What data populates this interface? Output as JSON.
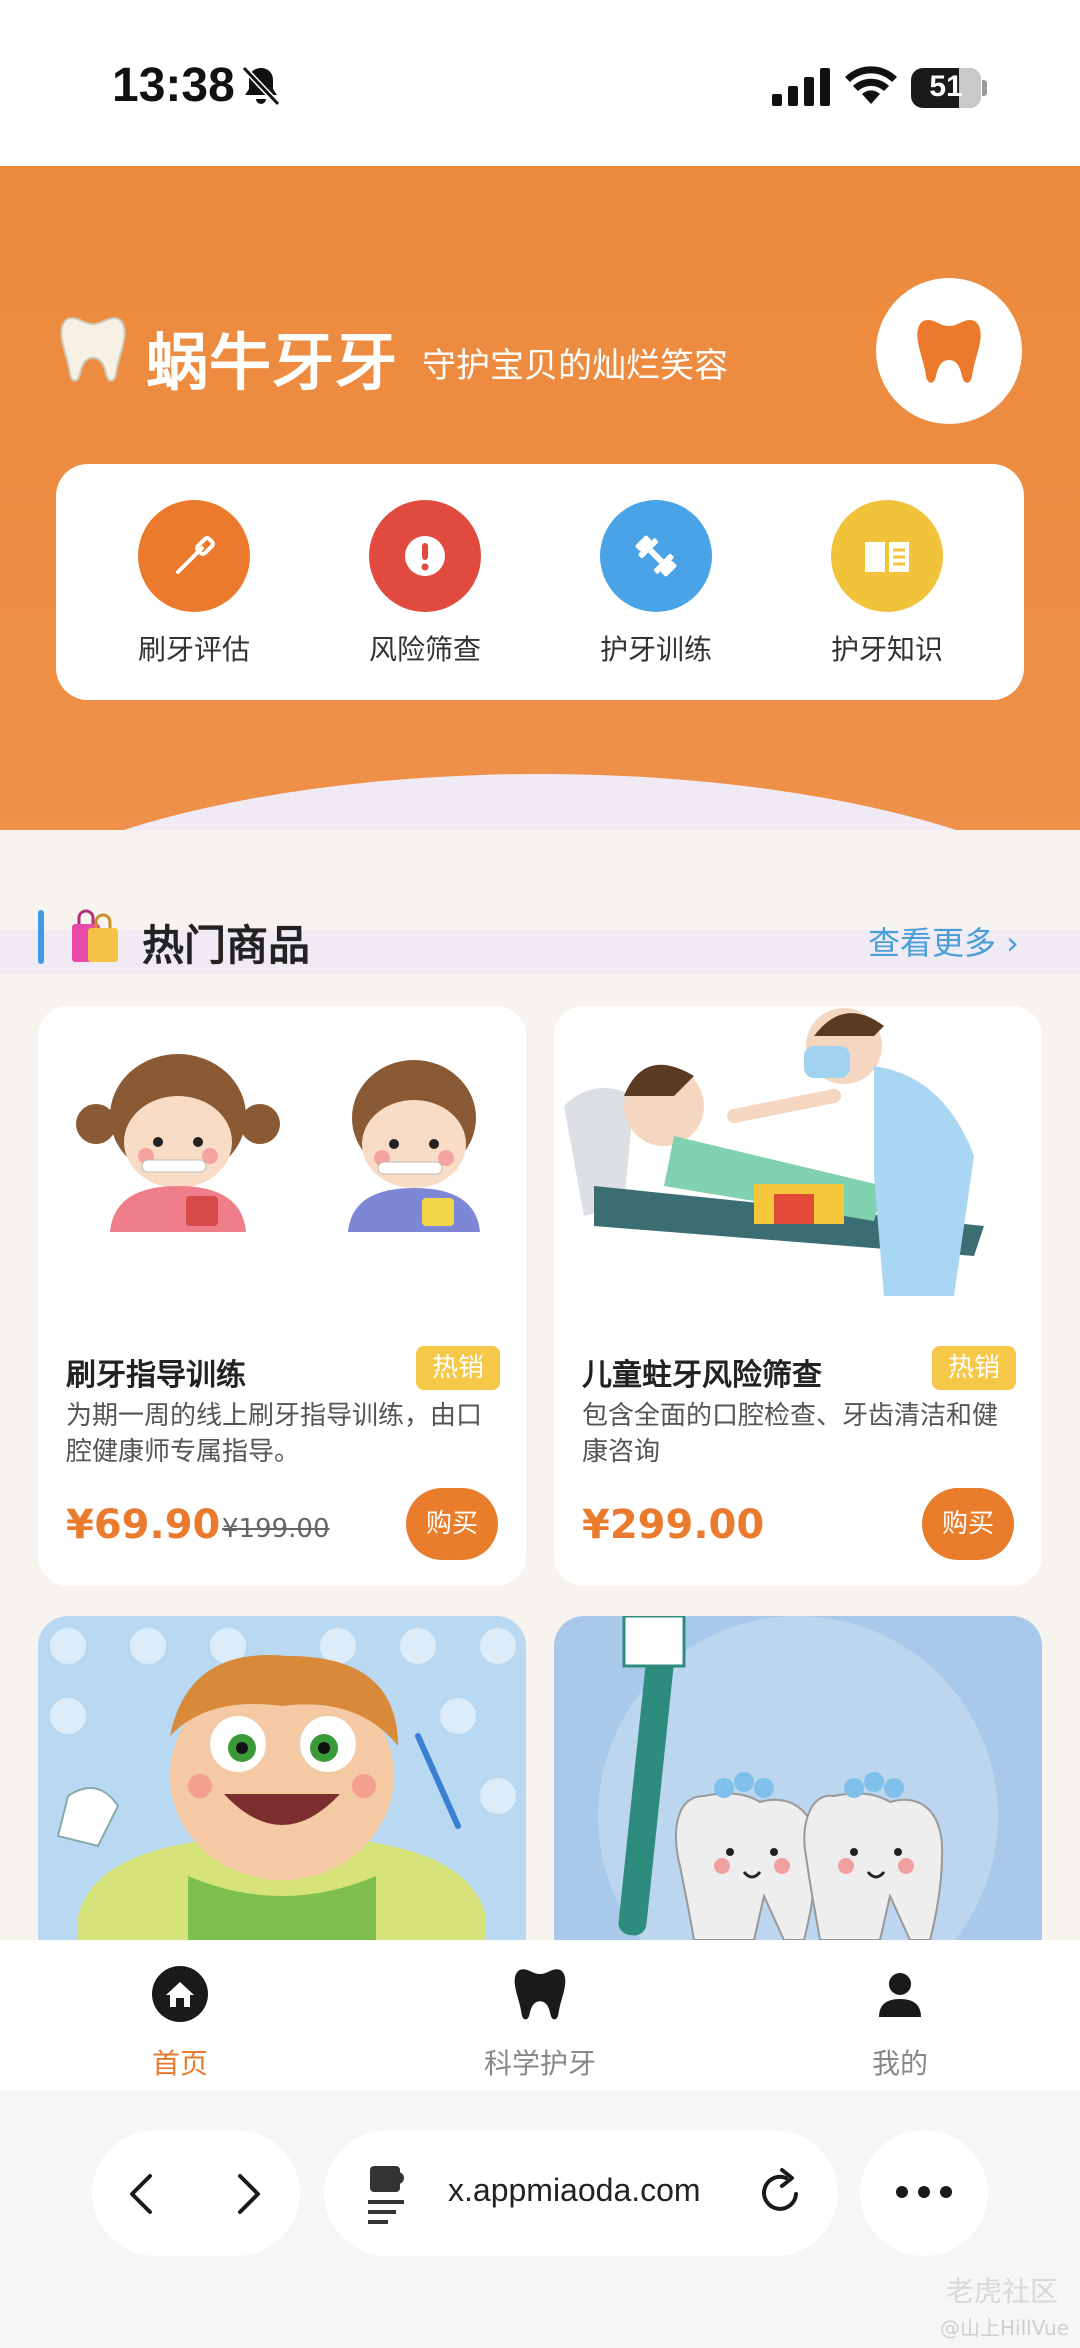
{
  "status_bar": {
    "time": "13:38",
    "battery": "51"
  },
  "header": {
    "app_name": "蜗牛牙牙",
    "slogan": "守护宝贝的灿烂笑容"
  },
  "quick_menu": [
    {
      "label": "刷牙评估",
      "icon": "toothbrush-icon",
      "color": "#ec7a2c"
    },
    {
      "label": "风险筛查",
      "icon": "alert-icon",
      "color": "#e04a3f"
    },
    {
      "label": "护牙训练",
      "icon": "dumbbell-icon",
      "color": "#4aa3e6"
    },
    {
      "label": "护牙知识",
      "icon": "book-icon",
      "color": "#f0c33a"
    }
  ],
  "section": {
    "title": "热门商品",
    "more": "查看更多 ›"
  },
  "products": [
    {
      "title": "刷牙指导训练",
      "badge": "热销",
      "desc": "为期一周的线上刷牙指导训练，由口腔健康师专属指导。",
      "price": "¥69.90",
      "old_price": "¥199.00",
      "buy": "购买"
    },
    {
      "title": "儿童蛀牙风险筛查",
      "badge": "热销",
      "desc": "包含全面的口腔检查、牙齿清洁和健康咨询",
      "price": "¥299.00",
      "old_price": "",
      "buy": "购买"
    }
  ],
  "tabs": [
    {
      "label": "首页",
      "active": true
    },
    {
      "label": "科学护牙",
      "active": false
    },
    {
      "label": "我的",
      "active": false
    }
  ],
  "browser": {
    "url": "x.appmiaoda.com"
  },
  "watermark": {
    "line1": "老虎社区",
    "line2": "@山上HillVue"
  },
  "colors": {
    "accent": "#ec8a3c",
    "price": "#e97a2e",
    "link": "#4a9fd8",
    "badge": "#f5c84a"
  }
}
